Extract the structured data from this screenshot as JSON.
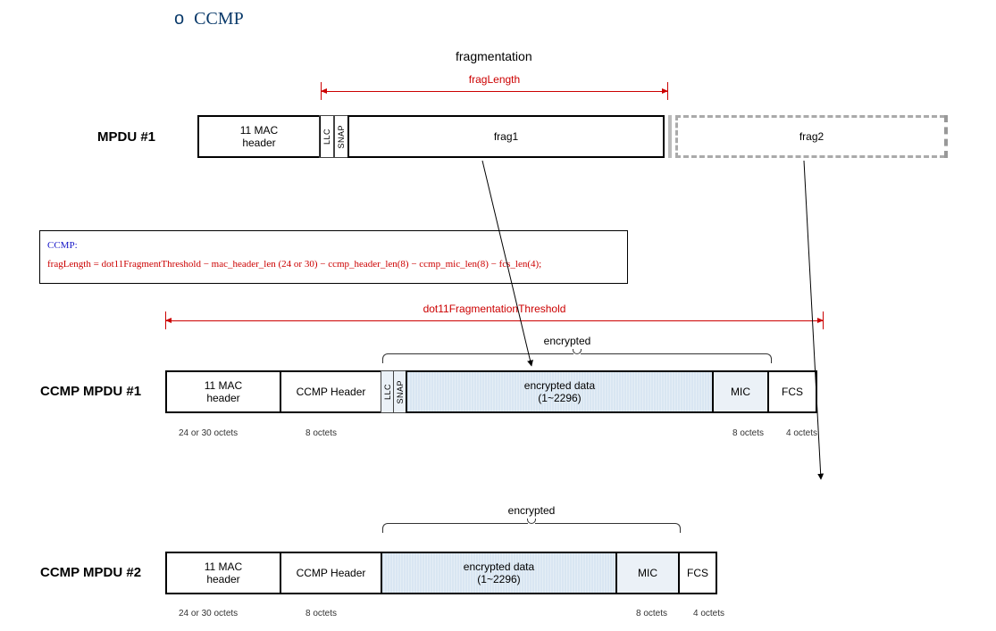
{
  "header": {
    "bullet": "o",
    "title": "CCMP"
  },
  "top_title": "fragmentation",
  "dim_fraglength": "fragLength",
  "dim_threshold": "dot11FragmentationThreshold",
  "row1": {
    "label": "MPDU #1",
    "cells": {
      "mac": "11 MAC\nheader",
      "llc": "LLC",
      "snap": "SNAP",
      "frag1": "frag1",
      "frag2": "frag2"
    }
  },
  "formula": {
    "line1": "CCMP:",
    "line2": "fragLength = dot11FragmentThreshold − mac_header_len (24 or 30) − ccmp_header_len(8) − ccmp_mic_len(8) − fcs_len(4);"
  },
  "encrypted_label": "encrypted",
  "row2": {
    "label": "CCMP MPDU #1",
    "cells": {
      "mac": "11 MAC\nheader",
      "ccmp": "CCMP Header",
      "llc": "LLC",
      "snap": "SNAP",
      "data": "encrypted data\n(1~2296)",
      "mic": "MIC",
      "fcs": "FCS"
    },
    "octets": {
      "mac": "24 or 30 octets",
      "ccmp": "8 octets",
      "mic": "8 octets",
      "fcs": "4 octets"
    }
  },
  "row3": {
    "label": "CCMP MPDU #2",
    "cells": {
      "mac": "11 MAC\nheader",
      "ccmp": "CCMP Header",
      "data": "encrypted data\n(1~2296)",
      "mic": "MIC",
      "fcs": "FCS"
    },
    "octets": {
      "mac": "24 or 30 octets",
      "ccmp": "8 octets",
      "mic": "8 octets",
      "fcs": "4 octets"
    }
  }
}
